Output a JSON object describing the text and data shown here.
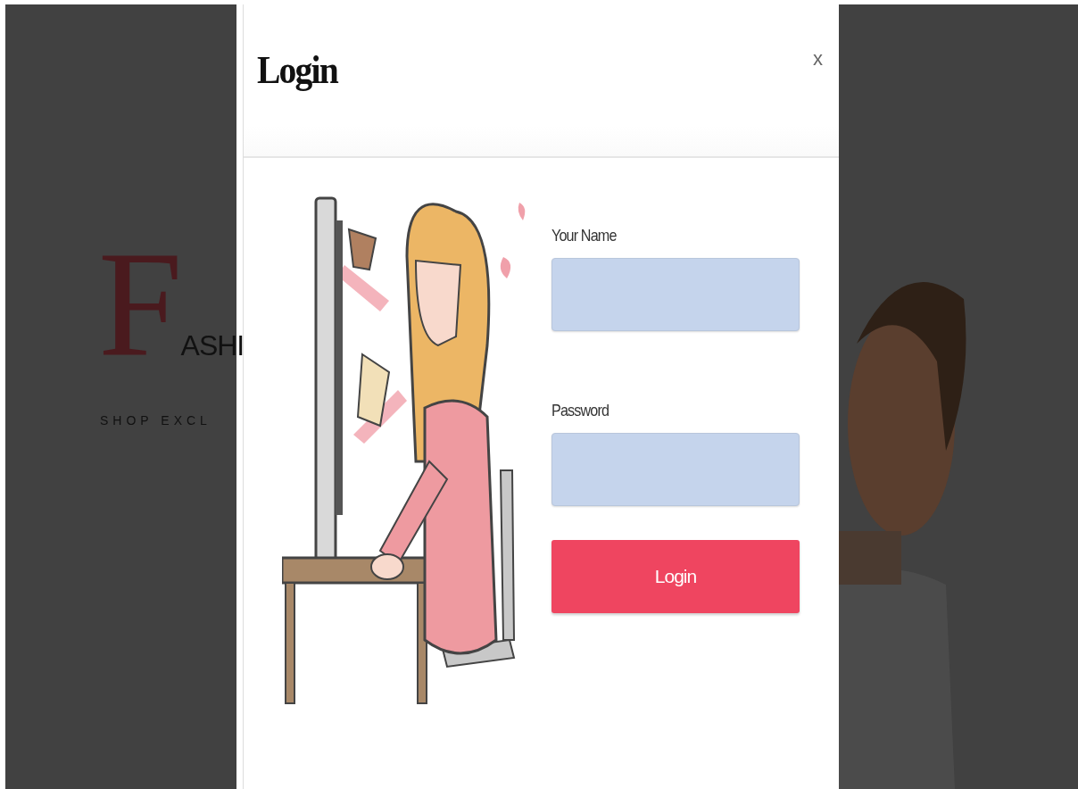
{
  "background": {
    "logo": {
      "initial": "F",
      "rest": "ASHI",
      "tagline": "SHOP EXCL"
    }
  },
  "modal": {
    "title": "Login",
    "close": "x",
    "fields": [
      {
        "label": "Your Name"
      },
      {
        "label": "Password"
      }
    ],
    "submit": "Login"
  }
}
